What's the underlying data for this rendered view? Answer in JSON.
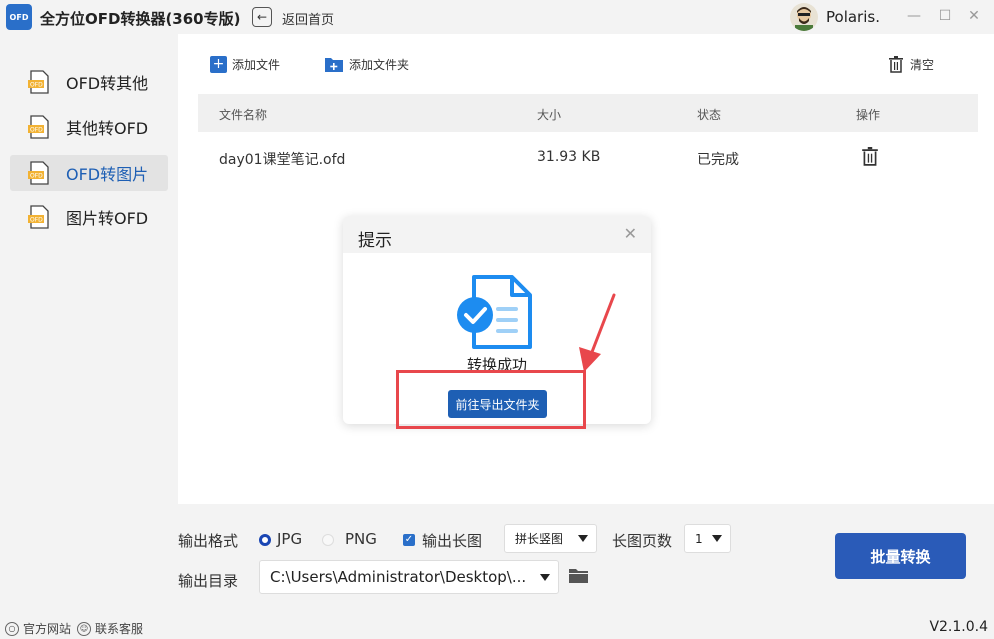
{
  "app": {
    "logo_text": "OFD",
    "title": "全方位OFD转换器(360专版)",
    "back_label": "返回首页",
    "username": "Polaris.",
    "version": "V2.1.0.4"
  },
  "window_controls": {
    "minimize": "—",
    "maximize": "☐",
    "close": "✕"
  },
  "sidebar": {
    "items": [
      {
        "label": "OFD转其他",
        "active": false
      },
      {
        "label": "其他转OFD",
        "active": false
      },
      {
        "label": "OFD转图片",
        "active": true
      },
      {
        "label": "图片转OFD",
        "active": false
      }
    ]
  },
  "toolbar": {
    "add_file": "添加文件",
    "add_folder": "添加文件夹",
    "clear": "清空"
  },
  "table": {
    "columns": [
      "文件名称",
      "大小",
      "状态",
      "操作"
    ],
    "rows": [
      {
        "name": "day01课堂笔记.ofd",
        "size": "31.93 KB",
        "status": "已完成"
      }
    ]
  },
  "settings": {
    "format_label": "输出格式",
    "format_options": [
      "JPG",
      "PNG"
    ],
    "format_selected": "JPG",
    "long_image_label": "输出长图",
    "long_image_checked": true,
    "stitch_mode": "拼长竖图",
    "pages_label": "长图页数",
    "pages_value": "1",
    "output_dir_label": "输出目录",
    "output_dir_value": "C:\\Users\\Administrator\\Desktop\\...",
    "batch_button": "批量转换"
  },
  "footer": {
    "website": "官方网站",
    "support": "联系客服"
  },
  "dialog": {
    "title": "提示",
    "message": "转换成功",
    "open_folder_button": "前往导出文件夹"
  },
  "colors": {
    "accent": "#2a6fc9",
    "primary_button": "#2a5bb8",
    "highlight": "#e8474c"
  }
}
